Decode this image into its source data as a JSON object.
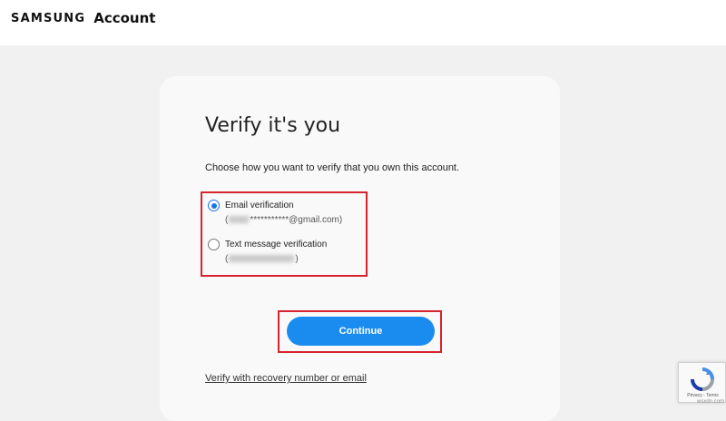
{
  "header": {
    "brand_samsung": "SAMSUNG",
    "brand_account": "Account"
  },
  "verify": {
    "title": "Verify it's you",
    "description": "Choose how you want to verify that you own this account.",
    "options": [
      {
        "label": "Email verification",
        "detail_prefix": "(",
        "detail_suffix": "***********@gmail.com)",
        "selected": true
      },
      {
        "label": "Text message verification",
        "detail_prefix": "(",
        "detail_suffix": ")",
        "selected": false
      }
    ],
    "continue_label": "Continue",
    "recovery_link": "Verify with recovery number or email"
  },
  "recaptcha": {
    "privacy": "Privacy",
    "separator": " - ",
    "terms": "Terms"
  },
  "watermark": "wsxdn.com",
  "colors": {
    "accent": "#1a8cf0",
    "highlight_border": "#d6232f",
    "background": "#f1f1f1",
    "card": "#f9f9fa"
  }
}
